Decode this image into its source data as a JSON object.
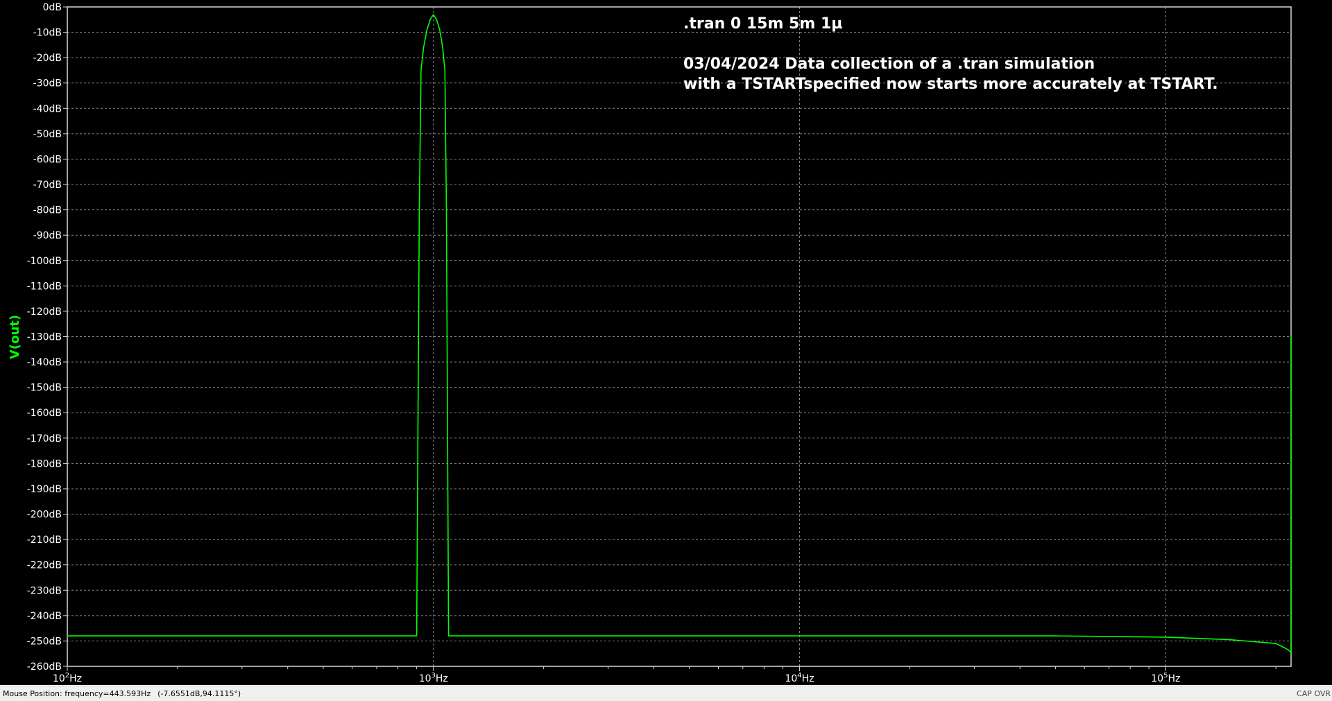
{
  "chart_data": {
    "type": "line",
    "title": "",
    "xlabel": "",
    "ylabel": "V(out)",
    "x_scale": "log",
    "xlim": [
      100,
      220000
    ],
    "ylim": [
      -260,
      0
    ],
    "y_ticks": [
      0,
      -10,
      -20,
      -30,
      -40,
      -50,
      -60,
      -70,
      -80,
      -90,
      -100,
      -110,
      -120,
      -130,
      -140,
      -150,
      -160,
      -170,
      -180,
      -190,
      -200,
      -210,
      -220,
      -230,
      -240,
      -250,
      -260
    ],
    "y_tick_labels": [
      "0dB",
      "-10dB",
      "-20dB",
      "-30dB",
      "-40dB",
      "-50dB",
      "-60dB",
      "-70dB",
      "-80dB",
      "-90dB",
      "-100dB",
      "-110dB",
      "-120dB",
      "-130dB",
      "-140dB",
      "-150dB",
      "-160dB",
      "-170dB",
      "-180dB",
      "-190dB",
      "-200dB",
      "-210dB",
      "-220dB",
      "-230dB",
      "-240dB",
      "-250dB",
      "-260dB"
    ],
    "x_major_ticks": [
      100,
      1000,
      10000,
      100000
    ],
    "x_tick_labels": [
      {
        "base": "10",
        "exp": "2",
        "unit": "Hz"
      },
      {
        "base": "10",
        "exp": "3",
        "unit": "Hz"
      },
      {
        "base": "10",
        "exp": "4",
        "unit": "Hz"
      },
      {
        "base": "10",
        "exp": "5",
        "unit": "Hz"
      }
    ],
    "grid": true,
    "series": [
      {
        "name": "V(out)",
        "color": "#00ff00",
        "x": [
          100,
          900,
          900,
          915,
          925,
          940,
          960,
          980,
          1000,
          1020,
          1040,
          1060,
          1075,
          1085,
          1100,
          1100,
          10000,
          50000,
          100000,
          150000,
          200000,
          210000,
          216000,
          220000,
          220000
        ],
        "y": [
          -248,
          -248,
          -248,
          -80,
          -25,
          -16,
          -9,
          -5,
          -3,
          -5,
          -9,
          -16,
          -25,
          -80,
          -248,
          -248,
          -248,
          -248,
          -248.5,
          -249.5,
          -251,
          -252.5,
          -253.5,
          -254.5,
          -130
        ]
      }
    ]
  },
  "annotations": {
    "directive": ".tran 0 15m 5m 1µ",
    "note_line1": "03/04/2024 Data collection of a .tran simulation",
    "note_line2": "with a TSTARTspecified now starts more accurately at TSTART."
  },
  "status_bar": {
    "mouse_position": "Mouse Position: frequency=443.593Hz",
    "mouse_value": "(-7.6551dB,94.1115°)",
    "keys": "CAP OVR"
  },
  "colors": {
    "background": "#000000",
    "axis_text": "#ffffff",
    "grid": "#8a8a8a",
    "trace": "#00ff00",
    "ylabel": "#00ff00",
    "annotation": "#ffffff"
  }
}
